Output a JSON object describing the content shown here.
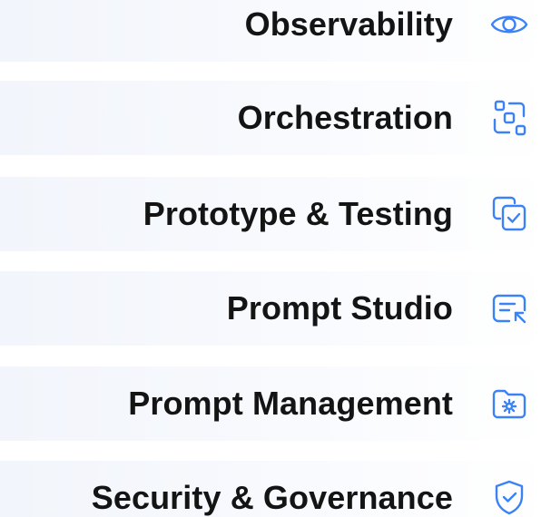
{
  "accent": "#3b82f6",
  "features": [
    {
      "label": "Observability",
      "icon": "eye-icon"
    },
    {
      "label": "Orchestration",
      "icon": "scan-nodes-icon"
    },
    {
      "label": "Prototype & Testing",
      "icon": "copy-check-icon"
    },
    {
      "label": "Prompt Studio",
      "icon": "text-cursor-icon"
    },
    {
      "label": "Prompt Management",
      "icon": "folder-gear-icon"
    },
    {
      "label": "Security & Governance",
      "icon": "shield-check-icon"
    }
  ]
}
